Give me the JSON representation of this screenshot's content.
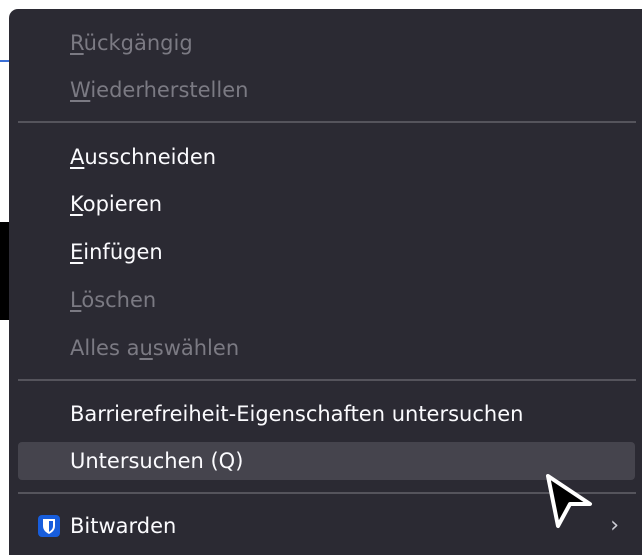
{
  "menu": {
    "items": [
      {
        "pre": "",
        "key": "R",
        "post": "ückgängig",
        "enabled": false
      },
      {
        "pre": "",
        "key": "W",
        "post": "iederherstellen",
        "enabled": false
      },
      {
        "pre": "",
        "key": "A",
        "post": "usschneiden",
        "enabled": true
      },
      {
        "pre": "",
        "key": "K",
        "post": "opieren",
        "enabled": true
      },
      {
        "pre": "",
        "key": "E",
        "post": "infügen",
        "enabled": true
      },
      {
        "pre": "",
        "key": "L",
        "post": "öschen",
        "enabled": false
      },
      {
        "pre": "Alles a",
        "key": "u",
        "post": "swählen",
        "enabled": false
      },
      {
        "label": "Barrierefreiheit-Eigenschaften untersuchen",
        "enabled": true
      },
      {
        "label": "Untersuchen (Q)",
        "enabled": true,
        "highlighted": true
      },
      {
        "label": "Bitwarden",
        "enabled": true,
        "icon": "bitwarden-shield-icon",
        "submenu_indicator": "›"
      }
    ]
  },
  "colors": {
    "menu_background": "#2b2a33",
    "text_enabled": "#fbfbfe",
    "text_disabled": "#7b7a83",
    "highlight": "#45444d",
    "bitwarden_blue": "#175ddc"
  }
}
